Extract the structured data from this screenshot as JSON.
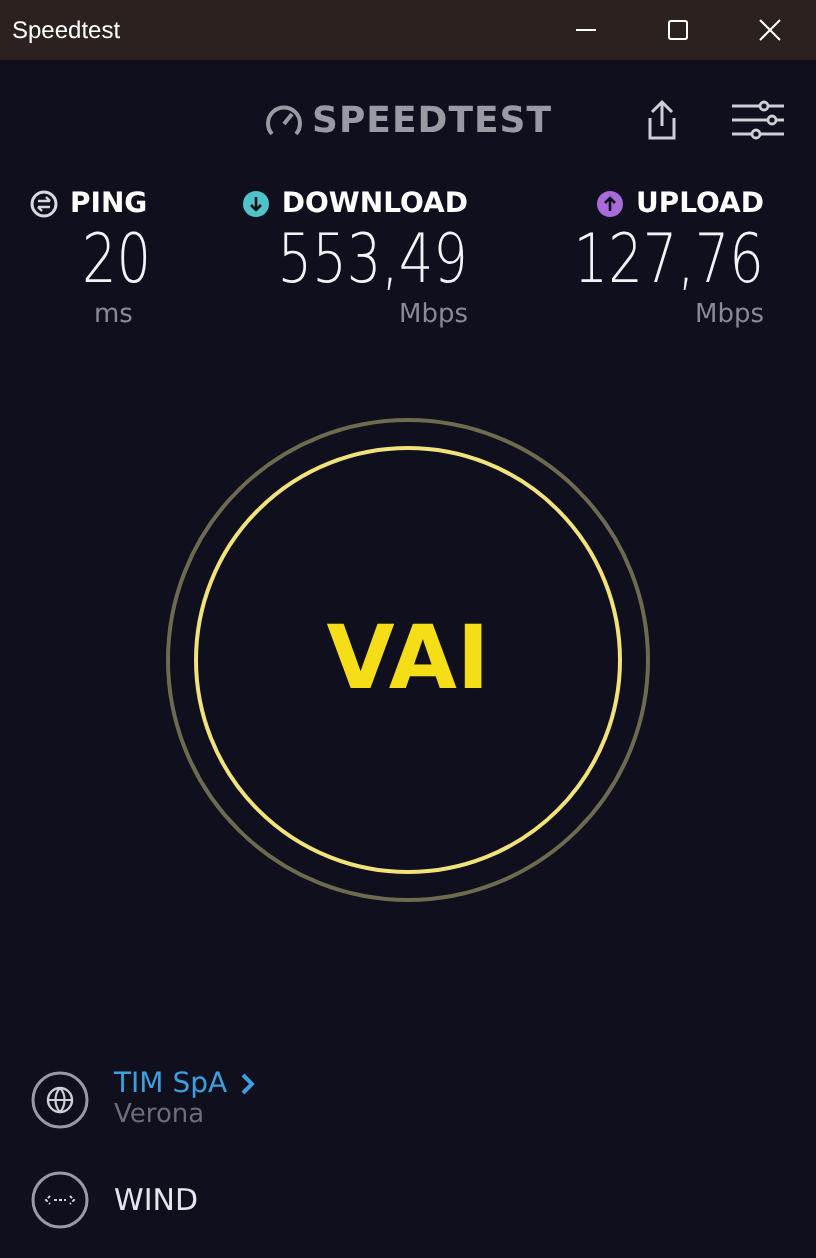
{
  "window": {
    "title": "Speedtest"
  },
  "logo": "SPEEDTEST",
  "metrics": [
    {
      "kind": "ping",
      "label": "PING",
      "value": "20",
      "unit": "ms"
    },
    {
      "kind": "download",
      "label": "DOWNLOAD",
      "value": "553,49",
      "unit": "Mbps"
    },
    {
      "kind": "upload",
      "label": "UPLOAD",
      "value": "127,76",
      "unit": "Mbps"
    }
  ],
  "go_button": "VAI",
  "provider": {
    "name": "TIM SpA",
    "location": "Verona"
  },
  "server": {
    "name": "WIND"
  }
}
